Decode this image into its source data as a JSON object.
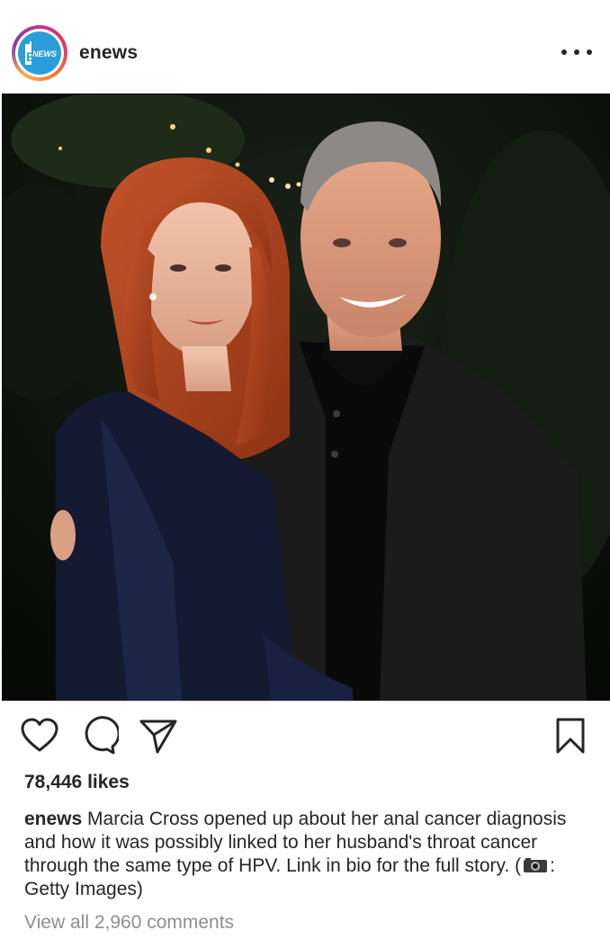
{
  "post": {
    "username": "enews",
    "avatar_text": "E NEWS",
    "likes": "78,446 likes",
    "caption_user": "enews",
    "caption_text": " Marcia Cross opened up about her anal cancer diagnosis and how it was possibly linked to her husband's throat cancer through the same type of HPV. Link in bio for the full story. (",
    "caption_credit": ": Getty Images)",
    "view_comments": "View all 2,960 comments"
  },
  "icons": {
    "more": "more-options-icon",
    "like": "heart-icon",
    "comment": "comment-icon",
    "share": "share-icon",
    "save": "bookmark-icon",
    "camera": "camera-emoji"
  },
  "colors": {
    "text": "#262626",
    "muted": "#8e8e8e",
    "avatar_bg": "#2a9ed8"
  }
}
